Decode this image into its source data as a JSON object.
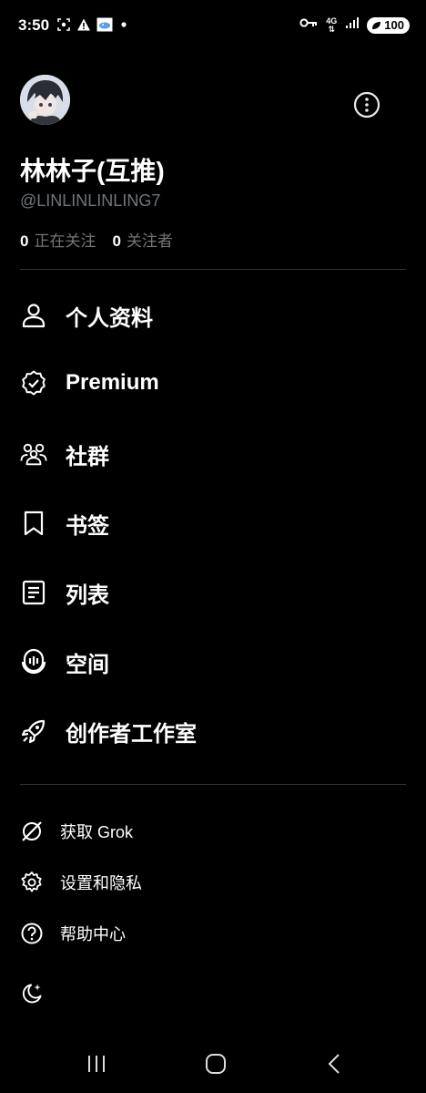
{
  "status_bar": {
    "time": "3:50",
    "network": "4G",
    "battery": "100"
  },
  "profile": {
    "display_name": "林林子(互推)",
    "handle": "@LINLINLINLING7",
    "following_count": "0",
    "following_label": "正在关注",
    "followers_count": "0",
    "followers_label": "关注者"
  },
  "menu": {
    "items": [
      {
        "label": "个人资料",
        "icon": "person-icon"
      },
      {
        "label": "Premium",
        "icon": "verified-badge-icon"
      },
      {
        "label": "社群",
        "icon": "communities-icon"
      },
      {
        "label": "书签",
        "icon": "bookmark-icon"
      },
      {
        "label": "列表",
        "icon": "list-icon"
      },
      {
        "label": "空间",
        "icon": "spaces-icon"
      },
      {
        "label": "创作者工作室",
        "icon": "rocket-icon"
      }
    ]
  },
  "secondary": {
    "items": [
      {
        "label": "获取 Grok",
        "icon": "grok-icon"
      },
      {
        "label": "设置和隐私",
        "icon": "gear-icon"
      },
      {
        "label": "帮助中心",
        "icon": "help-icon"
      }
    ]
  },
  "theme_toggle_icon": "moon-sparkle-icon"
}
